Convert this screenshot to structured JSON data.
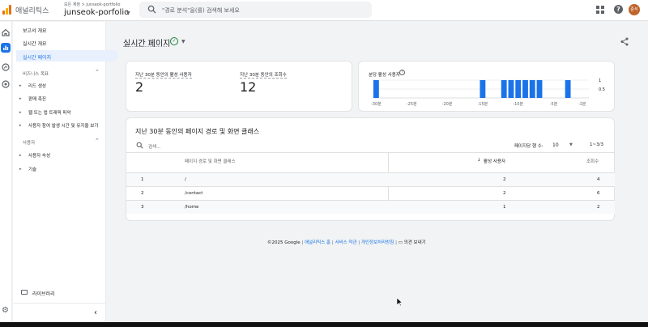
{
  "header": {
    "brand": "애널리틱스",
    "crumb": "모든 계정 > junseok-portfolio",
    "property": "junseok-porfolio",
    "search_placeholder": "\"경로 분석\"을(를) 검색해 보세요",
    "avatar_text": "준석"
  },
  "sidebar": {
    "items": [
      {
        "label": "보고서 개요"
      },
      {
        "label": "실시간 개요"
      },
      {
        "label": "실시간 페이지"
      }
    ],
    "section_business": "비즈니스 목표",
    "business_items": [
      {
        "label": "리드 생성"
      },
      {
        "label": "판매 촉진"
      },
      {
        "label": "웹 또는 앱 트래픽 파악"
      },
      {
        "label": "사용자 참여 발생 시간 및 유지율 보기"
      }
    ],
    "section_users": "사용자",
    "user_items": [
      {
        "label": "사용자 속성"
      },
      {
        "label": "기술"
      }
    ],
    "library": "라이브러리"
  },
  "page": {
    "title": "실시간 페이지"
  },
  "metrics": [
    {
      "label": "지난 30분 동안의 활성 사용자",
      "value": "2"
    },
    {
      "label": "지난 30분 동안의 조회수",
      "value": "12"
    }
  ],
  "mini_chart": {
    "label": "분당 활성 사용자",
    "y_ticks": [
      "1",
      "0.5"
    ],
    "x_ticks": [
      "-30분",
      "-25분",
      "-20분",
      "-15분",
      "-10분",
      "-5분",
      "-1분"
    ]
  },
  "chart_data": {
    "type": "bar",
    "title": "분당 활성 사용자",
    "x": [
      -30,
      -29,
      -28,
      -27,
      -26,
      -25,
      -24,
      -23,
      -22,
      -21,
      -20,
      -19,
      -18,
      -17,
      -16,
      -15,
      -14,
      -13,
      -12,
      -11,
      -10,
      -9,
      -8,
      -7,
      -6,
      -5,
      -4,
      -3,
      -2,
      -1
    ],
    "values": [
      1,
      0,
      0,
      0,
      0,
      0,
      0,
      0,
      0,
      0,
      0,
      0,
      0,
      0,
      0,
      1,
      0,
      0,
      1,
      1,
      1,
      1,
      1,
      1,
      0,
      0,
      0,
      1,
      0,
      0
    ],
    "ylim": [
      0,
      1
    ],
    "grid": true
  },
  "table": {
    "title": "지난 30분 동안의 페이지 경로 및 화면 클래스",
    "search_placeholder": "검색...",
    "rows_per_page_label": "페이지당 행 수:",
    "rows_per_page": "10",
    "range": "1~3/3",
    "columns": [
      "페이지 경로 및 화면 클래스",
      "활성 사용자",
      "조회수"
    ],
    "rows": [
      {
        "idx": "1",
        "path": "/",
        "users": "2",
        "views": "4"
      },
      {
        "idx": "2",
        "path": "/contact",
        "users": "2",
        "views": "6"
      },
      {
        "idx": "3",
        "path": "/home",
        "users": "1",
        "views": "2"
      }
    ]
  },
  "footer": {
    "copyright": "©2025 Google",
    "home": "애널리틱스 홈",
    "terms": "서비스 약관",
    "privacy": "개인정보처리방침",
    "feedback": "의견 보내기"
  },
  "colors": {
    "accent": "#1a73e8",
    "bar": "#1a73e8",
    "success": "#188038"
  }
}
